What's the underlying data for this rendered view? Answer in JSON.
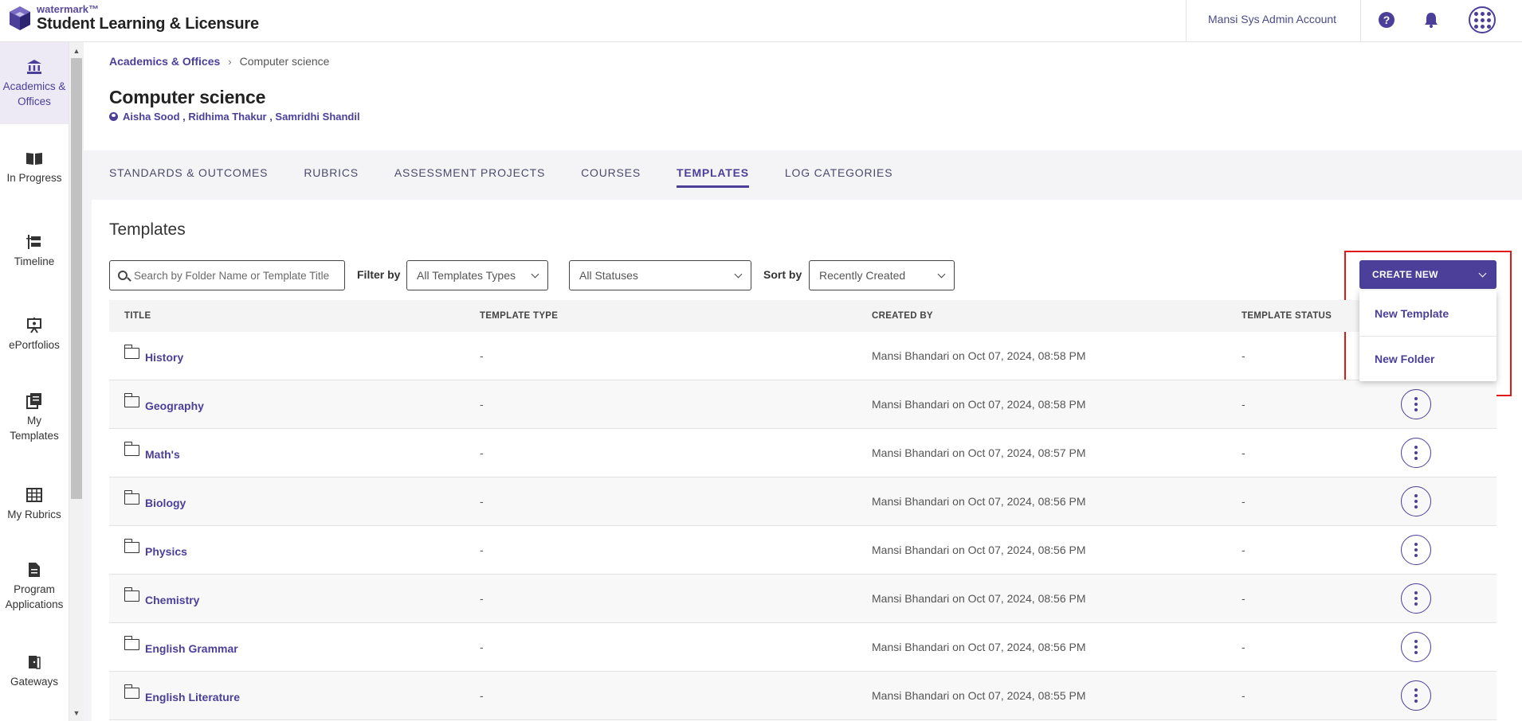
{
  "app": {
    "brand_small": "watermark™",
    "brand_name": "Student Learning & Licensure",
    "account_name": "Mansi Sys Admin Account"
  },
  "sidebar": {
    "items": [
      {
        "label": "Academics & Offices",
        "icon": "institution-icon",
        "active": true
      },
      {
        "label": "In Progress",
        "icon": "book-open-icon"
      },
      {
        "label": "Timeline",
        "icon": "timeline-icon"
      },
      {
        "label": "ePortfolios",
        "icon": "presentation-icon"
      },
      {
        "label": "My Templates",
        "icon": "templates-icon"
      },
      {
        "label": "My Rubrics",
        "icon": "grid-table-icon"
      },
      {
        "label": "Program Applications",
        "icon": "document-icon"
      },
      {
        "label": "Gateways",
        "icon": "door-icon"
      }
    ]
  },
  "breadcrumb": {
    "parent": "Academics & Offices",
    "separator": "›",
    "current": "Computer science"
  },
  "page": {
    "title": "Computer science",
    "owners": "Aisha Sood , Ridhima Thakur , Samridhi Shandil"
  },
  "tabs": [
    {
      "label": "STANDARDS & OUTCOMES"
    },
    {
      "label": "RUBRICS"
    },
    {
      "label": "ASSESSMENT PROJECTS"
    },
    {
      "label": "COURSES"
    },
    {
      "label": "TEMPLATES",
      "active": true
    },
    {
      "label": "LOG CATEGORIES"
    }
  ],
  "templates": {
    "section_title": "Templates",
    "search_placeholder": "Search by Folder Name or Template Title",
    "filter_label": "Filter by",
    "type_filter": "All Templates Types",
    "status_filter": "All Statuses",
    "sort_label": "Sort by",
    "sort_value": "Recently Created",
    "create_new": "CREATE NEW",
    "create_menu": [
      "New Template",
      "New Folder"
    ]
  },
  "table": {
    "headers": [
      "TITLE",
      "TEMPLATE TYPE",
      "CREATED BY",
      "TEMPLATE STATUS"
    ],
    "rows": [
      {
        "title": "History",
        "type": "-",
        "created_by": "Mansi Bhandari on Oct 07, 2024, 08:58 PM",
        "status": "-"
      },
      {
        "title": "Geography",
        "type": "-",
        "created_by": "Mansi Bhandari on Oct 07, 2024, 08:58 PM",
        "status": "-"
      },
      {
        "title": "Math's",
        "type": "-",
        "created_by": "Mansi Bhandari on Oct 07, 2024, 08:57 PM",
        "status": "-"
      },
      {
        "title": "Biology",
        "type": "-",
        "created_by": "Mansi Bhandari on Oct 07, 2024, 08:56 PM",
        "status": "-"
      },
      {
        "title": "Physics",
        "type": "-",
        "created_by": "Mansi Bhandari on Oct 07, 2024, 08:56 PM",
        "status": "-"
      },
      {
        "title": "Chemistry",
        "type": "-",
        "created_by": "Mansi Bhandari on Oct 07, 2024, 08:56 PM",
        "status": "-"
      },
      {
        "title": "English Grammar",
        "type": "-",
        "created_by": "Mansi Bhandari on Oct 07, 2024, 08:56 PM",
        "status": "-"
      },
      {
        "title": "English Literature",
        "type": "-",
        "created_by": "Mansi Bhandari on Oct 07, 2024, 08:55 PM",
        "status": "-"
      }
    ]
  },
  "colors": {
    "brand": "#4b3f9a",
    "highlight": "#e01818"
  }
}
